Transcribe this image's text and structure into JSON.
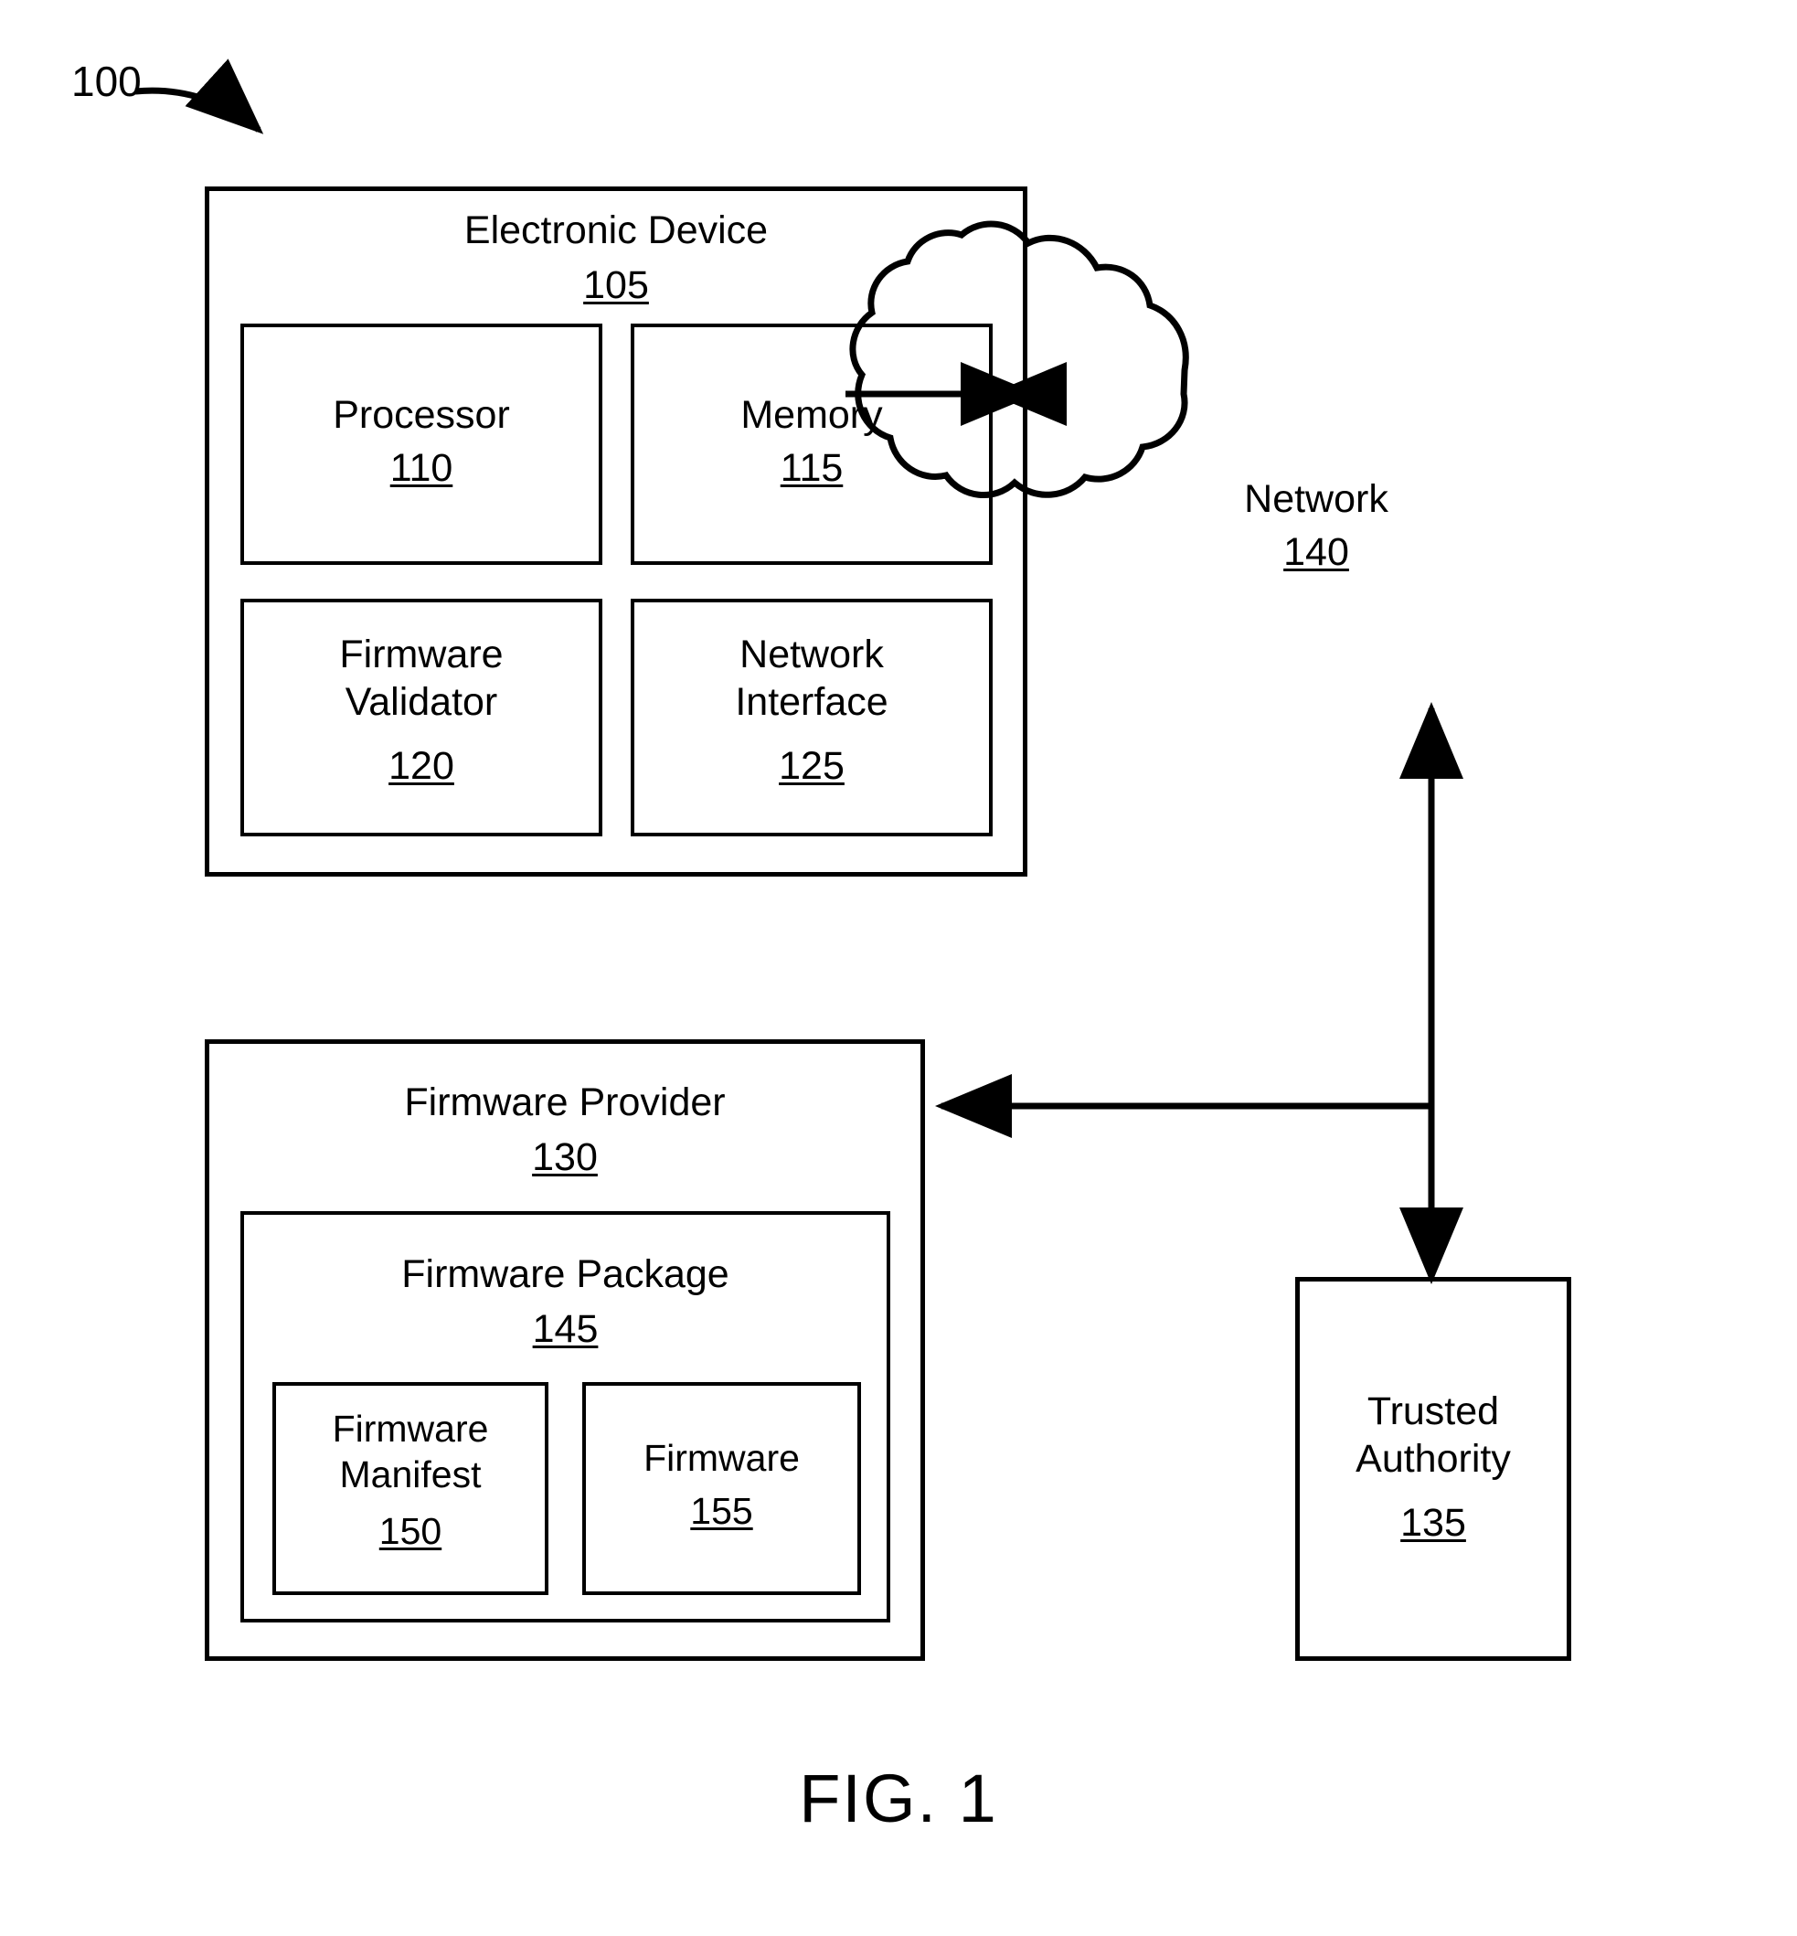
{
  "figure": {
    "caption": "FIG. 1",
    "system_ref": "100"
  },
  "blocks": {
    "electronic_device": {
      "label": "Electronic Device",
      "ref": "105"
    },
    "processor": {
      "label": "Processor",
      "ref": "110"
    },
    "memory": {
      "label": "Memory",
      "ref": "115"
    },
    "firmware_validator": {
      "label": "Firmware\nValidator",
      "ref": "120"
    },
    "network_interface": {
      "label": "Network\nInterface",
      "ref": "125"
    },
    "network": {
      "label": "Network",
      "ref": "140"
    },
    "firmware_provider": {
      "label": "Firmware Provider",
      "ref": "130"
    },
    "firmware_package": {
      "label": "Firmware Package",
      "ref": "145"
    },
    "firmware_manifest": {
      "label": "Firmware\nManifest",
      "ref": "150"
    },
    "firmware": {
      "label": "Firmware",
      "ref": "155"
    },
    "trusted_authority": {
      "label": "Trusted\nAuthority",
      "ref": "135"
    }
  },
  "connectors": {
    "device_network": "bidirectional-arrow-device-network",
    "authority_network": "arrow-trusted-authority-to-network",
    "network_provider": "arrow-network-to-firmware-provider",
    "network_authority": "arrow-network-to-trusted-authority",
    "lead_line_100": "curved-lead-line-with-arrowhead"
  },
  "colors": {
    "stroke": "#000000",
    "background": "#ffffff"
  }
}
